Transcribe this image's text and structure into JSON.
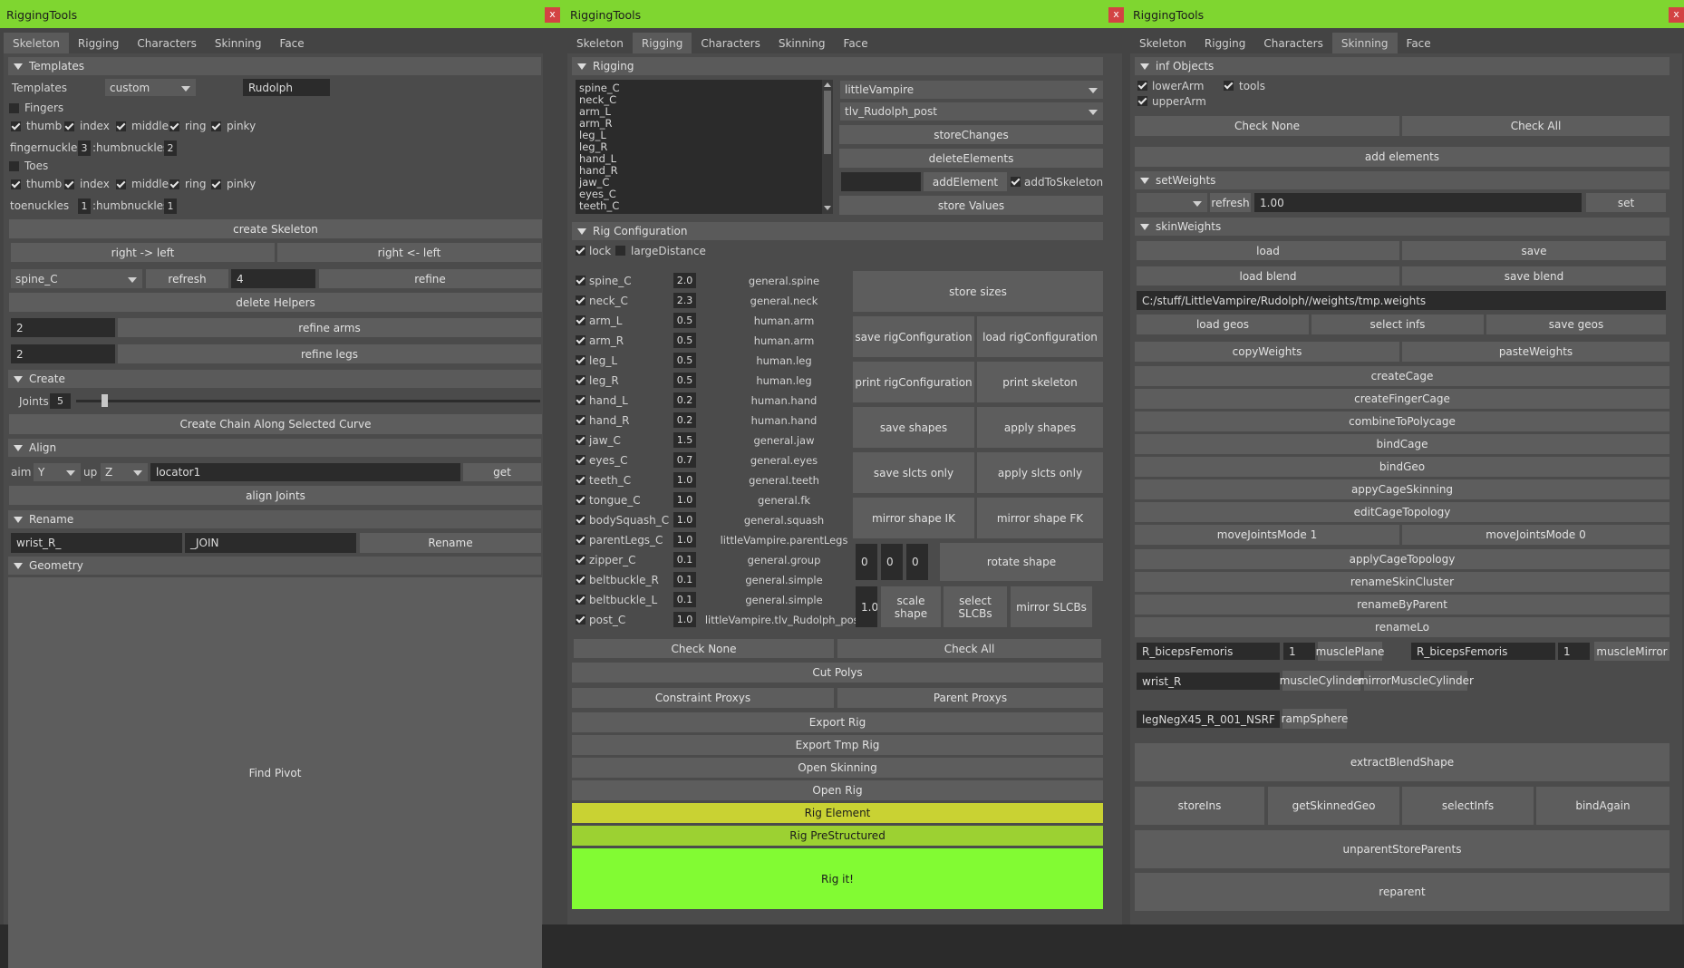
{
  "colors": {
    "title_bar": "#7fd630",
    "close": "#d34343",
    "rig_element": "#c9d233",
    "rig_prestructured": "#9cd132",
    "rig_it": "#82fb33"
  },
  "windows": [
    {
      "title": "RiggingTools",
      "close": "x"
    },
    {
      "title": "RiggingTools",
      "close": "x"
    },
    {
      "title": "RiggingTools",
      "close": "x"
    }
  ],
  "tabs": [
    "Skeleton",
    "Rigging",
    "Characters",
    "Skinning",
    "Face"
  ],
  "skeleton": {
    "templates_header": "Templates",
    "templates_label": "Templates",
    "template_select": "custom",
    "template_name": "Rudolph",
    "fingers_label": "Fingers",
    "digits": [
      "thumb",
      "index",
      "middle",
      "ring",
      "pinky"
    ],
    "fingernuckles_label": "fingernuckles",
    "fingernuckles_value": "3",
    "thumbnuckles_label": ":humbnuckles",
    "thumbnuckles_value": "2",
    "toes_label": "Toes",
    "toenuckles_label": "toenuckles",
    "toenuckles_value": "1",
    "toe_thumbnuckles_value": "1",
    "create_skeleton": "create Skeleton",
    "right_to_left": "right -> left",
    "left_to_right": "right <- left",
    "joint_select": "spine_C",
    "refresh": "refresh",
    "refine_value": "4",
    "refine": "refine",
    "delete_helpers": "delete Helpers",
    "refine_arms_value": "2",
    "refine_arms": "refine arms",
    "refine_legs_value": "2",
    "refine_legs": "refine legs",
    "create_header": "Create",
    "joints_label": "Joints",
    "joints_value": "5",
    "joints_slider_fraction": 0.06,
    "create_chain": "Create Chain Along Selected Curve",
    "align_header": "Align",
    "aim_label": "aim",
    "aim_value": "Y",
    "up_label": "up",
    "up_value": "Z",
    "locator": "locator1",
    "get": "get",
    "align_joints": "align Joints",
    "rename_header": "Rename",
    "rename_prefix": "wrist_R_",
    "rename_suffix": "_JOIN",
    "rename_button": "Rename",
    "geometry_header": "Geometry",
    "find_pivot": "Find Pivot"
  },
  "rigging": {
    "header": "Rigging",
    "joint_list": [
      "spine_C",
      "neck_C",
      "arm_L",
      "arm_R",
      "leg_L",
      "leg_R",
      "hand_L",
      "hand_R",
      "jaw_C",
      "eyes_C",
      "teeth_C"
    ],
    "character_select": "littleVampire",
    "rig_select": "tlv_Rudolph_post",
    "store_changes": "storeChanges",
    "delete_elements": "deleteElements",
    "add_element": "addElement",
    "add_to_skeleton": "addToSkeleton",
    "store_values": "store Values",
    "config_header": "Rig Configuration",
    "lock": "lock",
    "large_distance": "largeDistance",
    "rows": [
      {
        "name": "spine_C",
        "value": "2.0",
        "type": "general.spine"
      },
      {
        "name": "neck_C",
        "value": "2.3",
        "type": "general.neck"
      },
      {
        "name": "arm_L",
        "value": "0.5",
        "type": "human.arm"
      },
      {
        "name": "arm_R",
        "value": "0.5",
        "type": "human.arm"
      },
      {
        "name": "leg_L",
        "value": "0.5",
        "type": "human.leg"
      },
      {
        "name": "leg_R",
        "value": "0.5",
        "type": "human.leg"
      },
      {
        "name": "hand_L",
        "value": "0.2",
        "type": "human.hand"
      },
      {
        "name": "hand_R",
        "value": "0.2",
        "type": "human.hand"
      },
      {
        "name": "jaw_C",
        "value": "1.5",
        "type": "general.jaw"
      },
      {
        "name": "eyes_C",
        "value": "0.7",
        "type": "general.eyes"
      },
      {
        "name": "teeth_C",
        "value": "1.0",
        "type": "general.teeth"
      },
      {
        "name": "tongue_C",
        "value": "1.0",
        "type": "general.fk"
      },
      {
        "name": "bodySquash_C",
        "value": "1.0",
        "type": "general.squash"
      },
      {
        "name": "parentLegs_C",
        "value": "1.0",
        "type": "littleVampire.parentLegs"
      },
      {
        "name": "zipper_C",
        "value": "0.1",
        "type": "general.group"
      },
      {
        "name": "beltbuckle_R",
        "value": "0.1",
        "type": "general.simple"
      },
      {
        "name": "beltbuckle_L",
        "value": "0.1",
        "type": "general.simple"
      },
      {
        "name": "post_C",
        "value": "1.0",
        "type": "littleVampire.tlv_Rudolph_post"
      }
    ],
    "store_sizes": "store sizes",
    "save_rig_config": "save rigConfiguration",
    "load_rig_config": "load rigConfiguration",
    "print_rig_config": "print rigConfiguration",
    "print_skeleton": "print skeleton",
    "save_shapes": "save shapes",
    "apply_shapes": "apply shapes",
    "save_slcts": "save slcts only",
    "apply_slcts": "apply slcts only",
    "mirror_ik": "mirror shape IK",
    "mirror_fk": "mirror shape FK",
    "rot_x": "0",
    "rot_y": "0",
    "rot_z": "0",
    "rotate_shape": "rotate shape",
    "scale_value": "1.0",
    "scale_shape": "scale shape",
    "select_slcbs": "select SLCBs",
    "mirror_slcbs": "mirror SLCBs",
    "check_none": "Check None",
    "check_all": "Check All",
    "cut_polys": "Cut Polys",
    "constraint_proxys": "Constraint Proxys",
    "parent_proxys": "Parent Proxys",
    "export_rig": "Export Rig",
    "export_tmp_rig": "Export Tmp Rig",
    "open_skinning": "Open Skinning",
    "open_rig": "Open Rig",
    "rig_element": "Rig Element",
    "rig_prestructured": "Rig PreStructured",
    "rig_it": "Rig it!"
  },
  "skinning": {
    "inf_header": "inf Objects",
    "lower_arm": "lowerArm",
    "tools": "tools",
    "upper_arm": "upperArm",
    "check_none": "Check None",
    "check_all": "Check All",
    "add_elements": "add elements",
    "set_weights_header": "setWeights",
    "refresh": "refresh",
    "weight_value": "1.00",
    "set": "set",
    "skin_weights_header": "skinWeights",
    "load": "load",
    "save": "save",
    "load_blend": "load blend",
    "save_blend": "save blend",
    "weights_path": "C:/stuff/LittleVampire/Rudolph//weights/tmp.weights",
    "load_geos": "load geos",
    "select_infs": "select infs",
    "save_geos": "save geos",
    "copy_weights": "copyWeights",
    "paste_weights": "pasteWeights",
    "create_cage": "createCage",
    "create_finger_cage": "createFingerCage",
    "combine_to_polycage": "combineToPolycage",
    "bind_cage": "bindCage",
    "bind_geo": "bindGeo",
    "appy_cage_skinning": "appyCageSkinning",
    "edit_cage_topology": "editCageTopology",
    "move_joints_1": "moveJointsMode 1",
    "move_joints_0": "moveJointsMode 0",
    "apply_cage_topology": "applyCageTopology",
    "rename_skin_cluster": "renameSkinCluster",
    "rename_by_parent": "renameByParent",
    "rename_lo": "renameLo",
    "muscle_name": "R_bicepsFemoris",
    "muscle_count": "1",
    "muscle_plane": "musclePlane",
    "mirror_name": "R_bicepsFemoris",
    "mirror_count": "1",
    "muscle_mirror": "muscleMirror",
    "cylinder_name": "wrist_R",
    "muscle_cylinder": "muscleCylinder",
    "mirror_muscle_cylinder": "mirrorMuscleCylinder",
    "ramp_name": "legNegX45_R_001_NSRF",
    "ramp_sphere": "rampSphere",
    "extract_blend_shape": "extractBlendShape",
    "store_ins": "storeIns",
    "get_skinned_geo": "getSkinnedGeo",
    "select_infs2": "selectInfs",
    "bind_again": "bindAgain",
    "unparent_store_parents": "unparentStoreParents",
    "reparent": "reparent"
  }
}
